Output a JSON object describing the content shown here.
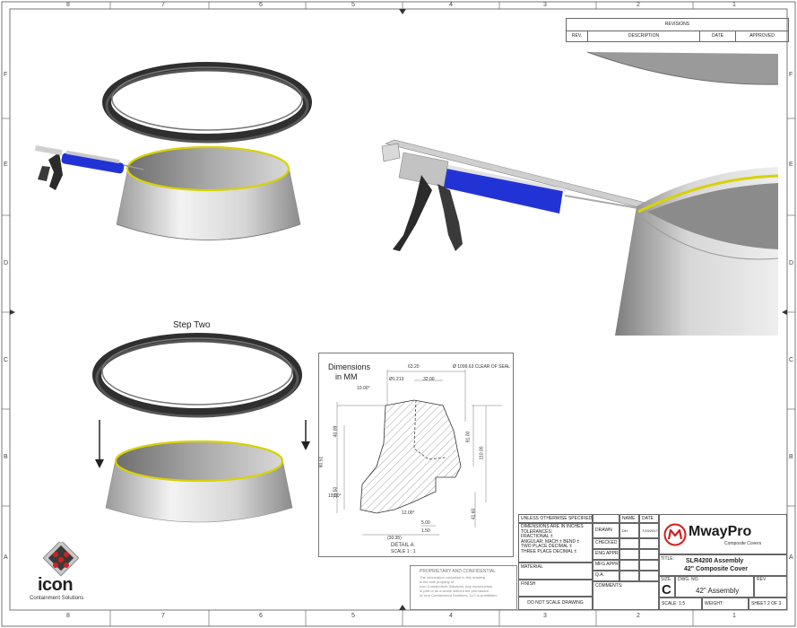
{
  "border_zones": {
    "top": [
      "8",
      "7",
      "6",
      "5",
      "4",
      "3",
      "2",
      "1"
    ],
    "bottom": [
      "8",
      "7",
      "6",
      "5",
      "4",
      "3",
      "2",
      "1"
    ],
    "left": [
      "F",
      "E",
      "D",
      "C",
      "B",
      "A"
    ],
    "right": [
      "F",
      "E",
      "D",
      "C",
      "B",
      "A"
    ]
  },
  "revisions": {
    "title": "REVISIONS",
    "columns": [
      "REV.",
      "DESCRIPTION",
      "DATE",
      "APPROVED"
    ]
  },
  "step_two_label": "Step Two",
  "detail": {
    "dimensions_title_1": "Dimensions",
    "dimensions_title_2": "in MM",
    "dims": [
      "63.20",
      "Ø 1099.63 CLEAR OF SEAL",
      "Ø1.213",
      "32.00",
      "10.00°",
      "40.09",
      "80.51",
      "10.50",
      "10.00°",
      "91.00",
      "110.00",
      "12.00°",
      "5.00",
      "1.50",
      "(30.35)",
      "41.60"
    ],
    "detail_label": "DETAIL A",
    "scale_label": "SCALE 1 : 1"
  },
  "notes": {
    "unless": "UNLESS OTHERWISE SPECIFIED:",
    "lines": [
      "DIMENSIONS ARE IN INCHES",
      "TOLERANCES:",
      "FRACTIONAL ±",
      "ANGULAR: MACH ±   BEND ±",
      "TWO PLACE DECIMAL   ±",
      "THREE PLACE DECIMAL   ±"
    ],
    "material": "MATERIAL",
    "finish": "FINISH",
    "do_not_scale": "DO NOT SCALE DRAWING"
  },
  "proprietary": {
    "title": "PROPRIETARY AND CONFIDENTIAL",
    "lines": [
      "The information contained in this drawing",
      "is the sole property of",
      "Icon Containment Solutions. Any reproduction",
      "in part or as a whole without the permission",
      "of Icon Containment Solutions, LLC is prohibited."
    ]
  },
  "signoff": {
    "name_header": "NAME",
    "date_header": "DATE",
    "rows": [
      {
        "label": "DRAWN",
        "name": "DH",
        "date": "7/19/2017"
      },
      {
        "label": "CHECKED",
        "name": "",
        "date": ""
      },
      {
        "label": "ENG APPR.",
        "name": "",
        "date": ""
      },
      {
        "label": "MFG APPR.",
        "name": "",
        "date": ""
      },
      {
        "label": "Q.A.",
        "name": "",
        "date": ""
      }
    ],
    "comments": "COMMENTS:"
  },
  "title_block": {
    "brand": "MwayPro",
    "brand_sub": "Composite Covers",
    "title_label": "TITLE:",
    "title_line1": "SLR4200 Assembly",
    "title_line2": "42\" Composite Cover",
    "size_label": "SIZE",
    "size_value": "C",
    "dwg_label": "DWG. NO.",
    "dwg_value": "42\" Assembly",
    "rev_label": "REV",
    "scale": "SCALE: 1:5",
    "weight": "WEIGHT:",
    "sheet": "SHEET 2 OF 3"
  },
  "logo": {
    "name": "icon",
    "sub": "Containment Solutions"
  },
  "colors": {
    "seal_blue": "#2233d6",
    "seal_yellow": "#d8d200",
    "gasket": "#3a3a3a"
  }
}
